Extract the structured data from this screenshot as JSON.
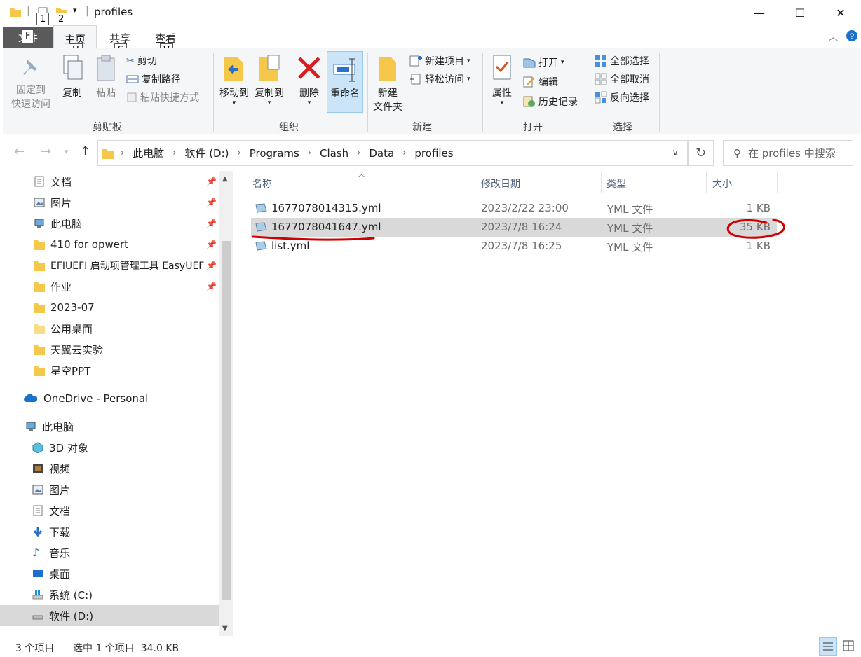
{
  "window": {
    "title": "profiles",
    "minimize_glyph": "—",
    "maximize_glyph": "☐",
    "close_glyph": "✕"
  },
  "keytips": {
    "file": "F",
    "one": "1",
    "two": "2",
    "home": "H",
    "share": "S",
    "view": "V"
  },
  "tabs": {
    "file": "文件",
    "home": "主页",
    "share": "共享",
    "view": "查看"
  },
  "ribbon": {
    "clipboard": {
      "pin_line1": "固定到",
      "pin_line2": "快速访问",
      "copy": "复制",
      "paste": "粘贴",
      "cut": "剪切",
      "copy_path": "复制路径",
      "paste_shortcut": "粘贴快捷方式",
      "label": "剪贴板"
    },
    "organize": {
      "move_to": "移动到",
      "copy_to": "复制到",
      "delete": "删除",
      "rename": "重命名",
      "label": "组织"
    },
    "new": {
      "new_folder_line1": "新建",
      "new_folder_line2": "文件夹",
      "new_item": "新建项目",
      "easy_access": "轻松访问",
      "label": "新建"
    },
    "open": {
      "properties": "属性",
      "open": "打开",
      "edit": "编辑",
      "history": "历史记录",
      "label": "打开"
    },
    "select": {
      "select_all": "全部选择",
      "select_none": "全部取消",
      "invert": "反向选择",
      "label": "选择"
    }
  },
  "address": {
    "crumbs": [
      "此电脑",
      "软件 (D:)",
      "Programs",
      "Clash",
      "Data",
      "profiles"
    ],
    "search_placeholder": "在 profiles 中搜索"
  },
  "sidebar": {
    "quick_access": [
      {
        "label": "文档",
        "pinned": true
      },
      {
        "label": "图片",
        "pinned": true
      },
      {
        "label": "此电脑",
        "pinned": true
      },
      {
        "label": "410 for opwert",
        "pinned": true
      },
      {
        "label": "EFIUEFI 启动项管理工具 EasyUEF",
        "pinned": true
      },
      {
        "label": "作业",
        "pinned": true
      },
      {
        "label": "2023-07",
        "pinned": false
      },
      {
        "label": "公用桌面",
        "pinned": false
      },
      {
        "label": "天翼云实验",
        "pinned": false
      },
      {
        "label": "星空PPT",
        "pinned": false
      }
    ],
    "onedrive": "OneDrive - Personal",
    "this_pc": "此电脑",
    "this_pc_items": [
      "3D 对象",
      "视频",
      "图片",
      "文档",
      "下载",
      "音乐",
      "桌面",
      "系统 (C:)",
      "软件 (D:)"
    ]
  },
  "columns": {
    "name": "名称",
    "modified": "修改日期",
    "type": "类型",
    "size": "大小"
  },
  "files": [
    {
      "name": "1677078014315.yml",
      "modified": "2023/2/22 23:00",
      "type": "YML 文件",
      "size": "1 KB",
      "selected": false
    },
    {
      "name": "1677078041647.yml",
      "modified": "2023/7/8 16:24",
      "type": "YML 文件",
      "size": "35 KB",
      "selected": true
    },
    {
      "name": "list.yml",
      "modified": "2023/7/8 16:25",
      "type": "YML 文件",
      "size": "1 KB",
      "selected": false
    }
  ],
  "status": {
    "count": "3 个项目",
    "selection": "选中 1 个项目  34.0 KB"
  },
  "colors": {
    "selected_bg": "#d9d9d9",
    "annotation_red": "#d10000",
    "folder_yellow": "#f5c84c"
  }
}
